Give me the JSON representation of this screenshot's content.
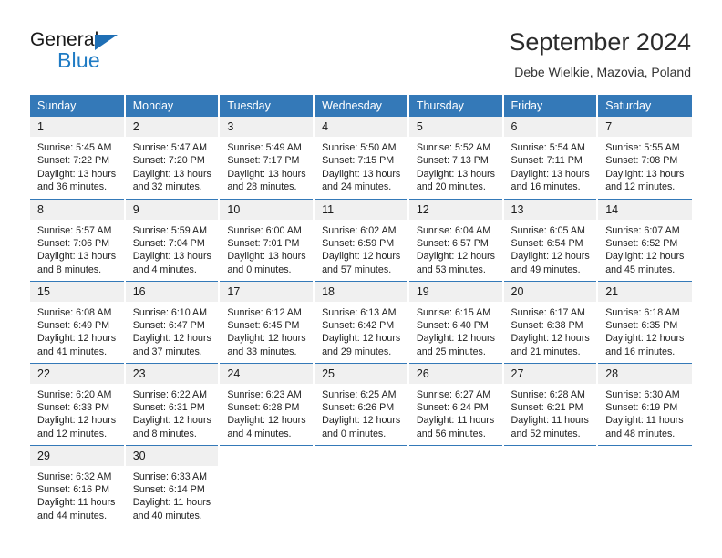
{
  "logo": {
    "word_one": "General",
    "word_two": "Blue",
    "triangle_color": "#1f6fb5",
    "blue_text_color": "#1f7bc4"
  },
  "header": {
    "title": "September 2024",
    "subtitle": "Debe Wielkie, Mazovia, Poland"
  },
  "theme": {
    "header_bg": "#3479b8",
    "daynum_bg": "#f0f0f0",
    "page_bg": "#ffffff"
  },
  "weekdays": [
    "Sunday",
    "Monday",
    "Tuesday",
    "Wednesday",
    "Thursday",
    "Friday",
    "Saturday"
  ],
  "weeks": [
    [
      {
        "day": "1",
        "sunrise": "Sunrise: 5:45 AM",
        "sunset": "Sunset: 7:22 PM",
        "daylight_line1": "Daylight: 13 hours",
        "daylight_line2": "and 36 minutes."
      },
      {
        "day": "2",
        "sunrise": "Sunrise: 5:47 AM",
        "sunset": "Sunset: 7:20 PM",
        "daylight_line1": "Daylight: 13 hours",
        "daylight_line2": "and 32 minutes."
      },
      {
        "day": "3",
        "sunrise": "Sunrise: 5:49 AM",
        "sunset": "Sunset: 7:17 PM",
        "daylight_line1": "Daylight: 13 hours",
        "daylight_line2": "and 28 minutes."
      },
      {
        "day": "4",
        "sunrise": "Sunrise: 5:50 AM",
        "sunset": "Sunset: 7:15 PM",
        "daylight_line1": "Daylight: 13 hours",
        "daylight_line2": "and 24 minutes."
      },
      {
        "day": "5",
        "sunrise": "Sunrise: 5:52 AM",
        "sunset": "Sunset: 7:13 PM",
        "daylight_line1": "Daylight: 13 hours",
        "daylight_line2": "and 20 minutes."
      },
      {
        "day": "6",
        "sunrise": "Sunrise: 5:54 AM",
        "sunset": "Sunset: 7:11 PM",
        "daylight_line1": "Daylight: 13 hours",
        "daylight_line2": "and 16 minutes."
      },
      {
        "day": "7",
        "sunrise": "Sunrise: 5:55 AM",
        "sunset": "Sunset: 7:08 PM",
        "daylight_line1": "Daylight: 13 hours",
        "daylight_line2": "and 12 minutes."
      }
    ],
    [
      {
        "day": "8",
        "sunrise": "Sunrise: 5:57 AM",
        "sunset": "Sunset: 7:06 PM",
        "daylight_line1": "Daylight: 13 hours",
        "daylight_line2": "and 8 minutes."
      },
      {
        "day": "9",
        "sunrise": "Sunrise: 5:59 AM",
        "sunset": "Sunset: 7:04 PM",
        "daylight_line1": "Daylight: 13 hours",
        "daylight_line2": "and 4 minutes."
      },
      {
        "day": "10",
        "sunrise": "Sunrise: 6:00 AM",
        "sunset": "Sunset: 7:01 PM",
        "daylight_line1": "Daylight: 13 hours",
        "daylight_line2": "and 0 minutes."
      },
      {
        "day": "11",
        "sunrise": "Sunrise: 6:02 AM",
        "sunset": "Sunset: 6:59 PM",
        "daylight_line1": "Daylight: 12 hours",
        "daylight_line2": "and 57 minutes."
      },
      {
        "day": "12",
        "sunrise": "Sunrise: 6:04 AM",
        "sunset": "Sunset: 6:57 PM",
        "daylight_line1": "Daylight: 12 hours",
        "daylight_line2": "and 53 minutes."
      },
      {
        "day": "13",
        "sunrise": "Sunrise: 6:05 AM",
        "sunset": "Sunset: 6:54 PM",
        "daylight_line1": "Daylight: 12 hours",
        "daylight_line2": "and 49 minutes."
      },
      {
        "day": "14",
        "sunrise": "Sunrise: 6:07 AM",
        "sunset": "Sunset: 6:52 PM",
        "daylight_line1": "Daylight: 12 hours",
        "daylight_line2": "and 45 minutes."
      }
    ],
    [
      {
        "day": "15",
        "sunrise": "Sunrise: 6:08 AM",
        "sunset": "Sunset: 6:49 PM",
        "daylight_line1": "Daylight: 12 hours",
        "daylight_line2": "and 41 minutes."
      },
      {
        "day": "16",
        "sunrise": "Sunrise: 6:10 AM",
        "sunset": "Sunset: 6:47 PM",
        "daylight_line1": "Daylight: 12 hours",
        "daylight_line2": "and 37 minutes."
      },
      {
        "day": "17",
        "sunrise": "Sunrise: 6:12 AM",
        "sunset": "Sunset: 6:45 PM",
        "daylight_line1": "Daylight: 12 hours",
        "daylight_line2": "and 33 minutes."
      },
      {
        "day": "18",
        "sunrise": "Sunrise: 6:13 AM",
        "sunset": "Sunset: 6:42 PM",
        "daylight_line1": "Daylight: 12 hours",
        "daylight_line2": "and 29 minutes."
      },
      {
        "day": "19",
        "sunrise": "Sunrise: 6:15 AM",
        "sunset": "Sunset: 6:40 PM",
        "daylight_line1": "Daylight: 12 hours",
        "daylight_line2": "and 25 minutes."
      },
      {
        "day": "20",
        "sunrise": "Sunrise: 6:17 AM",
        "sunset": "Sunset: 6:38 PM",
        "daylight_line1": "Daylight: 12 hours",
        "daylight_line2": "and 21 minutes."
      },
      {
        "day": "21",
        "sunrise": "Sunrise: 6:18 AM",
        "sunset": "Sunset: 6:35 PM",
        "daylight_line1": "Daylight: 12 hours",
        "daylight_line2": "and 16 minutes."
      }
    ],
    [
      {
        "day": "22",
        "sunrise": "Sunrise: 6:20 AM",
        "sunset": "Sunset: 6:33 PM",
        "daylight_line1": "Daylight: 12 hours",
        "daylight_line2": "and 12 minutes."
      },
      {
        "day": "23",
        "sunrise": "Sunrise: 6:22 AM",
        "sunset": "Sunset: 6:31 PM",
        "daylight_line1": "Daylight: 12 hours",
        "daylight_line2": "and 8 minutes."
      },
      {
        "day": "24",
        "sunrise": "Sunrise: 6:23 AM",
        "sunset": "Sunset: 6:28 PM",
        "daylight_line1": "Daylight: 12 hours",
        "daylight_line2": "and 4 minutes."
      },
      {
        "day": "25",
        "sunrise": "Sunrise: 6:25 AM",
        "sunset": "Sunset: 6:26 PM",
        "daylight_line1": "Daylight: 12 hours",
        "daylight_line2": "and 0 minutes."
      },
      {
        "day": "26",
        "sunrise": "Sunrise: 6:27 AM",
        "sunset": "Sunset: 6:24 PM",
        "daylight_line1": "Daylight: 11 hours",
        "daylight_line2": "and 56 minutes."
      },
      {
        "day": "27",
        "sunrise": "Sunrise: 6:28 AM",
        "sunset": "Sunset: 6:21 PM",
        "daylight_line1": "Daylight: 11 hours",
        "daylight_line2": "and 52 minutes."
      },
      {
        "day": "28",
        "sunrise": "Sunrise: 6:30 AM",
        "sunset": "Sunset: 6:19 PM",
        "daylight_line1": "Daylight: 11 hours",
        "daylight_line2": "and 48 minutes."
      }
    ],
    [
      {
        "day": "29",
        "sunrise": "Sunrise: 6:32 AM",
        "sunset": "Sunset: 6:16 PM",
        "daylight_line1": "Daylight: 11 hours",
        "daylight_line2": "and 44 minutes."
      },
      {
        "day": "30",
        "sunrise": "Sunrise: 6:33 AM",
        "sunset": "Sunset: 6:14 PM",
        "daylight_line1": "Daylight: 11 hours",
        "daylight_line2": "and 40 minutes."
      },
      {
        "day": "",
        "sunrise": "",
        "sunset": "",
        "daylight_line1": "",
        "daylight_line2": ""
      },
      {
        "day": "",
        "sunrise": "",
        "sunset": "",
        "daylight_line1": "",
        "daylight_line2": ""
      },
      {
        "day": "",
        "sunrise": "",
        "sunset": "",
        "daylight_line1": "",
        "daylight_line2": ""
      },
      {
        "day": "",
        "sunrise": "",
        "sunset": "",
        "daylight_line1": "",
        "daylight_line2": ""
      },
      {
        "day": "",
        "sunrise": "",
        "sunset": "",
        "daylight_line1": "",
        "daylight_line2": ""
      }
    ]
  ]
}
